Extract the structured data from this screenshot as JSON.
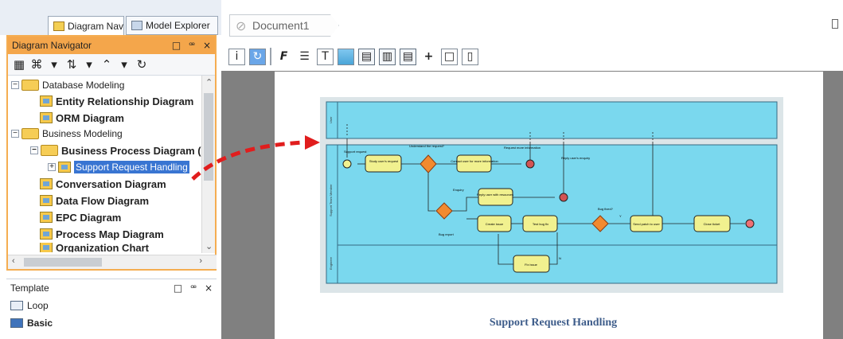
{
  "tabs": [
    {
      "label": "Diagram Navi..."
    },
    {
      "label": "Model Explorer"
    }
  ],
  "navigator": {
    "title": "Diagram Navigator",
    "controls": [
      "□",
      "ꟹ",
      "×"
    ],
    "toolbar_icons": [
      "grid-icon",
      "structure-icon",
      "arrow-down-icon",
      "sort-icon",
      "dropdown-icon",
      "up-arrow-icon",
      "dropdown-icon",
      "refresh-icon"
    ],
    "tree": [
      {
        "label": "Database Modeling",
        "level": 0,
        "type": "folder"
      },
      {
        "label": "Entity Relationship Diagram",
        "level": 1,
        "type": "diagram"
      },
      {
        "label": "ORM Diagram",
        "level": 1,
        "type": "diagram"
      },
      {
        "label": "Business Modeling",
        "level": 0,
        "type": "folder"
      },
      {
        "label": "Business Process Diagram (",
        "level": 1,
        "type": "folder"
      },
      {
        "label": "Support Request Handling",
        "level": 2,
        "type": "diagram",
        "selected": true
      },
      {
        "label": "Conversation Diagram",
        "level": 1,
        "type": "diagram"
      },
      {
        "label": "Data Flow Diagram",
        "level": 1,
        "type": "diagram"
      },
      {
        "label": "EPC Diagram",
        "level": 1,
        "type": "diagram"
      },
      {
        "label": "Process Map Diagram",
        "level": 1,
        "type": "diagram"
      },
      {
        "label": "Organization Chart",
        "level": 1,
        "type": "diagram"
      }
    ]
  },
  "template": {
    "title": "Template",
    "controls": [
      "□",
      "ꟹ",
      "×"
    ],
    "items": [
      {
        "label": "Loop"
      },
      {
        "label": "Basic"
      }
    ]
  },
  "document": {
    "tab": "Document1",
    "page_title": "Support Request Handling"
  },
  "colors": {
    "panel_accent": "#f4a64b",
    "selection": "#3975d2",
    "canvas": "#808080",
    "diagram_background": "#7ad8ee",
    "task": "#f1f18f",
    "gateway": "#f28a2f",
    "drag_arrow": "#e11d1d"
  },
  "diagram": {
    "lanes": [
      "User",
      "Support Team Member",
      "Engineer"
    ],
    "flows": [
      "Support request",
      "Understand the request?",
      "Request more information",
      "Reply user's enquiry",
      "Enquiry",
      "Bug report",
      "Bug fixed?",
      "N",
      "Y"
    ],
    "tasks": [
      "Study user's request",
      "Contact user for more information",
      "Reply user with resources",
      "Create issue",
      "Test bug fix",
      "Send patch to user",
      "Close ticket",
      "Fix issue"
    ]
  }
}
